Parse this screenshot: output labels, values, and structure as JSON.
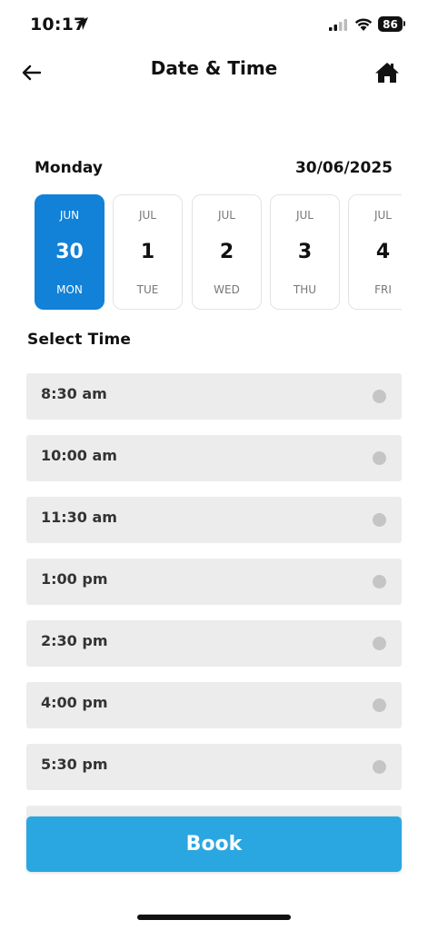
{
  "status_bar": {
    "time": "10:17",
    "battery": "86"
  },
  "header": {
    "title": "Date & Time"
  },
  "selected_date": {
    "weekday": "Monday",
    "date": "30/06/2025"
  },
  "dates": [
    {
      "month": "JUN",
      "day": "30",
      "weekday": "MON",
      "selected": true
    },
    {
      "month": "JUL",
      "day": "1",
      "weekday": "TUE",
      "selected": false
    },
    {
      "month": "JUL",
      "day": "2",
      "weekday": "WED",
      "selected": false
    },
    {
      "month": "JUL",
      "day": "3",
      "weekday": "THU",
      "selected": false
    },
    {
      "month": "JUL",
      "day": "4",
      "weekday": "FRI",
      "selected": false
    }
  ],
  "time_section": {
    "title": "Select Time"
  },
  "time_slots": [
    "8:30 am",
    "10:00 am",
    "11:30 am",
    "1:00 pm",
    "2:30 pm",
    "4:00 pm",
    "5:30 pm"
  ],
  "book_button": {
    "label": "Book"
  },
  "colors": {
    "selected": "#1281d8",
    "book": "#2aa7e0",
    "slot": "#ececec",
    "radio": "#c5c5c5"
  }
}
